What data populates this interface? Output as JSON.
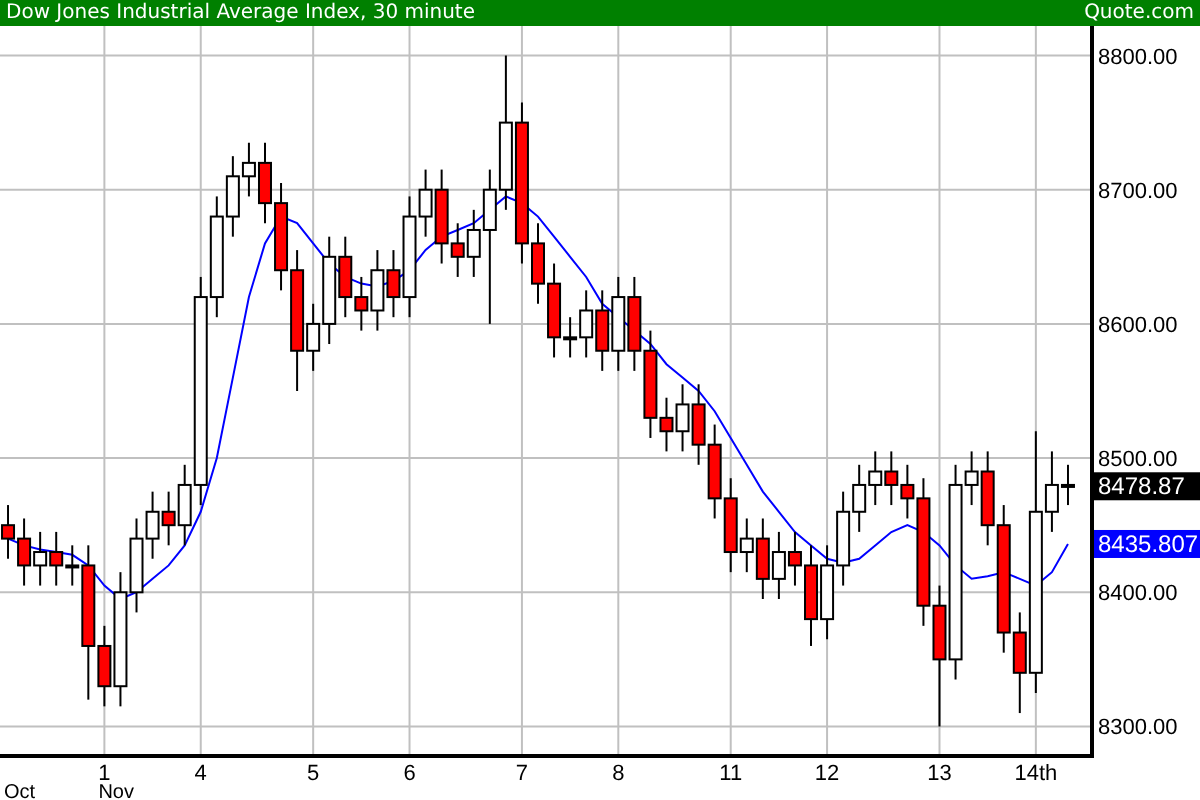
{
  "header": {
    "title": "Dow Jones Industrial Average Index, 30 minute",
    "source": "Quote.com"
  },
  "chart_data": {
    "type": "candlestick",
    "categories": [
      null,
      null,
      null,
      null,
      null,
      null,
      "1",
      null,
      null,
      null,
      null,
      null,
      "4",
      null,
      null,
      null,
      null,
      null,
      null,
      "5",
      null,
      null,
      null,
      null,
      null,
      "6",
      null,
      null,
      null,
      null,
      null,
      null,
      "7",
      null,
      null,
      null,
      null,
      null,
      "8",
      null,
      null,
      null,
      null,
      null,
      null,
      "11",
      null,
      null,
      null,
      null,
      null,
      "12",
      null,
      null,
      null,
      null,
      null,
      null,
      "13",
      null,
      null,
      null,
      null,
      null,
      "14th",
      null,
      null
    ],
    "ohlc": [
      [
        8450,
        8465,
        8425,
        8440
      ],
      [
        8440,
        8455,
        8405,
        8420
      ],
      [
        8420,
        8445,
        8405,
        8430
      ],
      [
        8430,
        8445,
        8405,
        8420
      ],
      [
        8420,
        8435,
        8405,
        8420
      ],
      [
        8420,
        8435,
        8320,
        8360
      ],
      [
        8360,
        8375,
        8315,
        8330
      ],
      [
        8330,
        8415,
        8315,
        8400
      ],
      [
        8400,
        8455,
        8385,
        8440
      ],
      [
        8440,
        8475,
        8425,
        8460
      ],
      [
        8460,
        8475,
        8435,
        8450
      ],
      [
        8450,
        8495,
        8435,
        8480
      ],
      [
        8480,
        8635,
        8465,
        8620
      ],
      [
        8620,
        8695,
        8605,
        8680
      ],
      [
        8680,
        8725,
        8665,
        8710
      ],
      [
        8710,
        8735,
        8695,
        8720
      ],
      [
        8720,
        8735,
        8675,
        8690
      ],
      [
        8690,
        8705,
        8625,
        8640
      ],
      [
        8640,
        8655,
        8550,
        8580
      ],
      [
        8580,
        8615,
        8565,
        8600
      ],
      [
        8600,
        8665,
        8585,
        8650
      ],
      [
        8650,
        8665,
        8605,
        8620
      ],
      [
        8620,
        8635,
        8595,
        8610
      ],
      [
        8610,
        8655,
        8595,
        8640
      ],
      [
        8640,
        8655,
        8605,
        8620
      ],
      [
        8620,
        8695,
        8605,
        8680
      ],
      [
        8680,
        8715,
        8665,
        8700
      ],
      [
        8700,
        8715,
        8645,
        8660
      ],
      [
        8660,
        8675,
        8635,
        8650
      ],
      [
        8650,
        8685,
        8635,
        8670
      ],
      [
        8670,
        8715,
        8600,
        8700
      ],
      [
        8700,
        8800,
        8685,
        8750
      ],
      [
        8750,
        8765,
        8645,
        8660
      ],
      [
        8660,
        8675,
        8615,
        8630
      ],
      [
        8630,
        8645,
        8575,
        8590
      ],
      [
        8590,
        8605,
        8575,
        8590
      ],
      [
        8590,
        8625,
        8575,
        8610
      ],
      [
        8610,
        8625,
        8565,
        8580
      ],
      [
        8580,
        8635,
        8565,
        8620
      ],
      [
        8620,
        8635,
        8565,
        8580
      ],
      [
        8580,
        8595,
        8515,
        8530
      ],
      [
        8530,
        8545,
        8505,
        8520
      ],
      [
        8520,
        8555,
        8505,
        8540
      ],
      [
        8540,
        8555,
        8495,
        8510
      ],
      [
        8510,
        8525,
        8455,
        8470
      ],
      [
        8470,
        8485,
        8415,
        8430
      ],
      [
        8430,
        8455,
        8415,
        8440
      ],
      [
        8440,
        8455,
        8395,
        8410
      ],
      [
        8410,
        8445,
        8395,
        8430
      ],
      [
        8430,
        8445,
        8405,
        8420
      ],
      [
        8420,
        8435,
        8360,
        8380
      ],
      [
        8380,
        8435,
        8365,
        8420
      ],
      [
        8420,
        8475,
        8405,
        8460
      ],
      [
        8460,
        8495,
        8445,
        8480
      ],
      [
        8480,
        8505,
        8465,
        8490
      ],
      [
        8490,
        8505,
        8465,
        8480
      ],
      [
        8480,
        8495,
        8455,
        8470
      ],
      [
        8470,
        8485,
        8375,
        8390
      ],
      [
        8390,
        8405,
        8300,
        8350
      ],
      [
        8350,
        8495,
        8335,
        8480
      ],
      [
        8480,
        8505,
        8465,
        8490
      ],
      [
        8490,
        8505,
        8435,
        8450
      ],
      [
        8450,
        8465,
        8355,
        8370
      ],
      [
        8370,
        8385,
        8310,
        8340
      ],
      [
        8340,
        8520,
        8325,
        8460
      ],
      [
        8460,
        8505,
        8445,
        8480
      ],
      [
        8480,
        8495,
        8465,
        8479
      ]
    ],
    "series": [
      {
        "type": "line",
        "color": "#0000ff",
        "values": [
          8440,
          8435,
          8432,
          8430,
          8428,
          8420,
          8405,
          8395,
          8400,
          8410,
          8420,
          8435,
          8460,
          8500,
          8560,
          8620,
          8660,
          8680,
          8675,
          8660,
          8645,
          8635,
          8630,
          8628,
          8632,
          8640,
          8655,
          8665,
          8670,
          8675,
          8685,
          8695,
          8690,
          8680,
          8665,
          8650,
          8635,
          8615,
          8605,
          8595,
          8585,
          8570,
          8560,
          8550,
          8535,
          8515,
          8495,
          8475,
          8460,
          8445,
          8435,
          8425,
          8422,
          8425,
          8435,
          8445,
          8450,
          8445,
          8435,
          8420,
          8410,
          8412,
          8415,
          8410,
          8405,
          8415,
          8436
        ]
      }
    ],
    "ylim": [
      8278,
      8822
    ],
    "yticks": [
      {
        "value": 8300,
        "label": "8300.00"
      },
      {
        "value": 8400,
        "label": "8400.00"
      },
      {
        "value": 8500,
        "label": "8500.00"
      },
      {
        "value": 8600,
        "label": "8600.00"
      },
      {
        "value": 8700,
        "label": "8700.00"
      },
      {
        "value": 8800,
        "label": "8800.00"
      }
    ],
    "grid": true,
    "annotations": [
      "Oct",
      "Nov"
    ]
  },
  "price_labels": [
    {
      "text": "8478.87",
      "color": "#000000"
    },
    {
      "text": "8435.807",
      "color": "#0000ff"
    }
  ]
}
